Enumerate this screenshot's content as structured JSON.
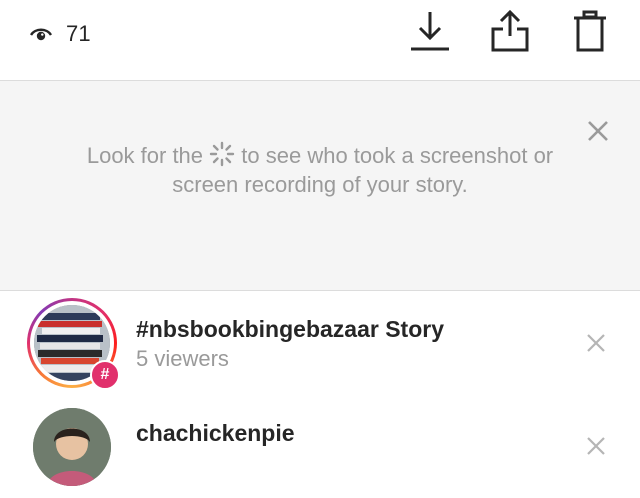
{
  "header": {
    "views_icon": "eye-icon",
    "view_count": "71",
    "actions": {
      "download_icon": "download-icon",
      "share_icon": "share-icon",
      "delete_icon": "trash-icon"
    }
  },
  "notice": {
    "text_before": "Look for the",
    "text_after": "to see who took a screenshot or screen recording of your story.",
    "inline_icon": "screenshot-sparkle-icon",
    "close_icon": "close-icon"
  },
  "viewers": [
    {
      "title": "#nbsbookbingebazaar Story",
      "subtitle": "5 viewers",
      "badge": "#",
      "close_icon": "close-icon"
    },
    {
      "title": "chachickenpie",
      "close_icon": "close-icon"
    }
  ]
}
